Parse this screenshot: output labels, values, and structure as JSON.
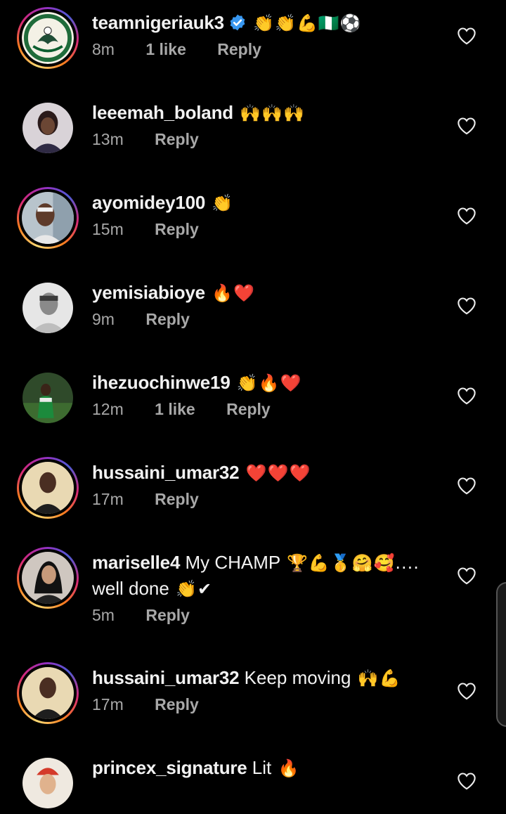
{
  "colors": {
    "background": "#000000",
    "primary_text": "#f2f2f2",
    "secondary_text": "#a8a8a8",
    "story_ring": "#d62976",
    "verified_badge": "#3897f0"
  },
  "comments": [
    {
      "username": "teamnigeriauk3",
      "verified": true,
      "text": "",
      "emojis": "👏👏💪🇳🇬⚽",
      "time": "8m",
      "likes": "1 like",
      "reply": "Reply",
      "avatar": "team-logo",
      "story_ring": true
    },
    {
      "username": "leeemah_boland",
      "verified": false,
      "text": "",
      "emojis": "🙌🙌🙌",
      "time": "13m",
      "likes": "",
      "reply": "Reply",
      "avatar": "person",
      "story_ring": false
    },
    {
      "username": "ayomidey100",
      "verified": false,
      "text": "",
      "emojis": "👏",
      "time": "15m",
      "likes": "",
      "reply": "Reply",
      "avatar": "person",
      "story_ring": true
    },
    {
      "username": "yemisiabioye",
      "verified": false,
      "text": "",
      "emojis": "🔥❤️",
      "time": "9m",
      "likes": "",
      "reply": "Reply",
      "avatar": "person",
      "story_ring": false
    },
    {
      "username": "ihezuochinwe19",
      "verified": false,
      "text": "",
      "emojis": "👏🔥❤️",
      "time": "12m",
      "likes": "1 like",
      "reply": "Reply",
      "avatar": "player",
      "story_ring": false
    },
    {
      "username": "hussaini_umar32",
      "verified": false,
      "text": "",
      "emojis": "❤️❤️❤️",
      "time": "17m",
      "likes": "",
      "reply": "Reply",
      "avatar": "person",
      "story_ring": true
    },
    {
      "username": "mariselle4",
      "verified": false,
      "text": " My CHAMP ",
      "emojis": "🏆💪🥇🤗🥰....",
      "text2": "well done ",
      "emojis2": "👏✔",
      "time": "5m",
      "likes": "",
      "reply": "Reply",
      "avatar": "person",
      "story_ring": true
    },
    {
      "username": "hussaini_umar32",
      "verified": false,
      "text": " Keep moving ",
      "emojis": "🙌💪",
      "time": "17m",
      "likes": "",
      "reply": "Reply",
      "avatar": "person",
      "story_ring": true
    },
    {
      "username": "princex_signature",
      "verified": false,
      "text": " Lit ",
      "emojis": "🔥",
      "time": "",
      "likes": "",
      "reply": "",
      "avatar": "person",
      "story_ring": false
    }
  ]
}
